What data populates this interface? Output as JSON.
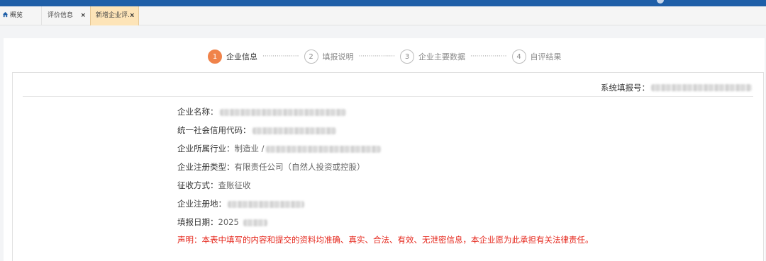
{
  "tabs": [
    {
      "label": "概览"
    },
    {
      "label": "评价信息",
      "close": "×"
    },
    {
      "label": "新增企业评...",
      "close": "×"
    }
  ],
  "steps": [
    {
      "num": "1",
      "label": "企业信息"
    },
    {
      "num": "2",
      "label": "填报说明"
    },
    {
      "num": "3",
      "label": "企业主要数据"
    },
    {
      "num": "4",
      "label": "自评结果"
    }
  ],
  "step_connector": "··················",
  "system_no_label": "系统填报号：",
  "fields": {
    "company_name": {
      "label": "企业名称："
    },
    "credit_code": {
      "label": "统一社会信用代码："
    },
    "industry": {
      "label": "企业所属行业：",
      "value": "制造业 /"
    },
    "reg_type": {
      "label": "企业注册类型：",
      "value": "有限责任公司（自然人投资或控股）"
    },
    "tax_method": {
      "label": "征收方式：",
      "value": "查账征收"
    },
    "reg_place": {
      "label": "企业注册地："
    },
    "fill_date": {
      "label": "填报日期：",
      "value": "2025"
    }
  },
  "declaration": "声明：本表中填写的内容和提交的资料均准确、真实、合法、有效、无泄密信息，本企业愿为此承担有关法律责任。",
  "colors": {
    "brand_bar": "#1f5fa8",
    "active_step": "#f0834a",
    "declaration": "#e5261b",
    "active_tab": "#fde4b8"
  }
}
